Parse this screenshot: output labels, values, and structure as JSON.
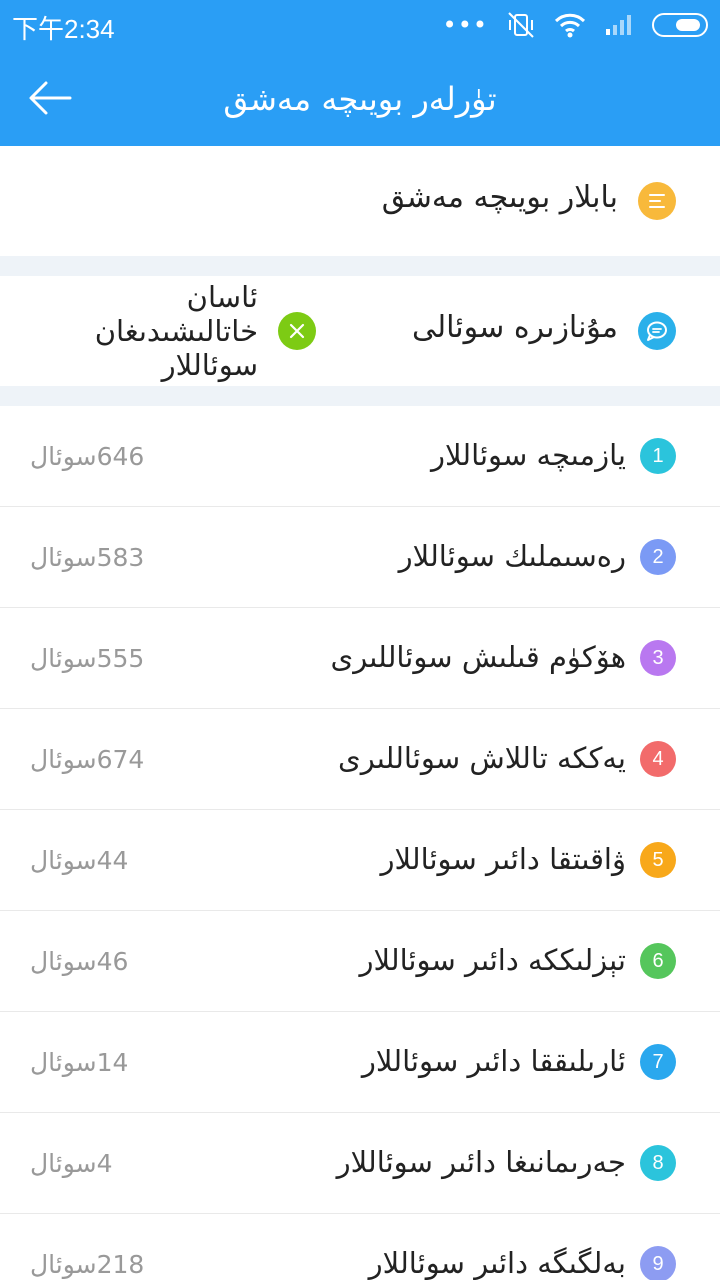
{
  "status_bar": {
    "time": "下午2:34",
    "dots": "•••"
  },
  "header": {
    "title": "تۈرلەر بويىچە مەشق",
    "back_icon": "arrow-left-icon",
    "color": "#2a9ef5"
  },
  "chapter_practice": {
    "label": "بابلار بويىچە مەشق",
    "icon": "list-icon",
    "icon_color": "#f8b93b"
  },
  "special_practice": {
    "label": "مۇنازىرە سوئالى",
    "icon": "chat-bubble-icon",
    "icon_color": "#2ab0ea",
    "wrong_questions": {
      "lines": [
        "ئاسان",
        "خاتالىشىدىغان",
        "سوئاللار"
      ],
      "icon": "close-circle-icon",
      "icon_color": "#7dcb14"
    }
  },
  "categories": [
    {
      "num": "1",
      "title": "يازمىچە سوئاللار",
      "count": "646سوئال",
      "color": "#2bc4dc"
    },
    {
      "num": "2",
      "title": "رەسىملىك سوئاللار",
      "count": "583سوئال",
      "color": "#7b9af5"
    },
    {
      "num": "3",
      "title": "ھۆكۈم قىلىش سوئاللىرى",
      "count": "555سوئال",
      "color": "#b978f0"
    },
    {
      "num": "4",
      "title": "يەككە تاللاش سوئاللىرى",
      "count": "674سوئال",
      "color": "#f26b6b"
    },
    {
      "num": "5",
      "title": "ۋاقىتقا دائىر سوئاللار",
      "count": "44سوئال",
      "color": "#f8a81a"
    },
    {
      "num": "6",
      "title": "تېزلىككە دائىر سوئاللار",
      "count": "46سوئال",
      "color": "#55c65c"
    },
    {
      "num": "7",
      "title": "ئارىلىققا دائىر سوئاللار",
      "count": "14سوئال",
      "color": "#2aa8ee"
    },
    {
      "num": "8",
      "title": "جەرىمانىغا دائىر سوئاللار",
      "count": "4سوئال",
      "color": "#2bc4dc"
    },
    {
      "num": "9",
      "title": "بەلگىگە دائىر سوئاللار",
      "count": "218سوئال",
      "color": "#8d9cf2"
    }
  ]
}
